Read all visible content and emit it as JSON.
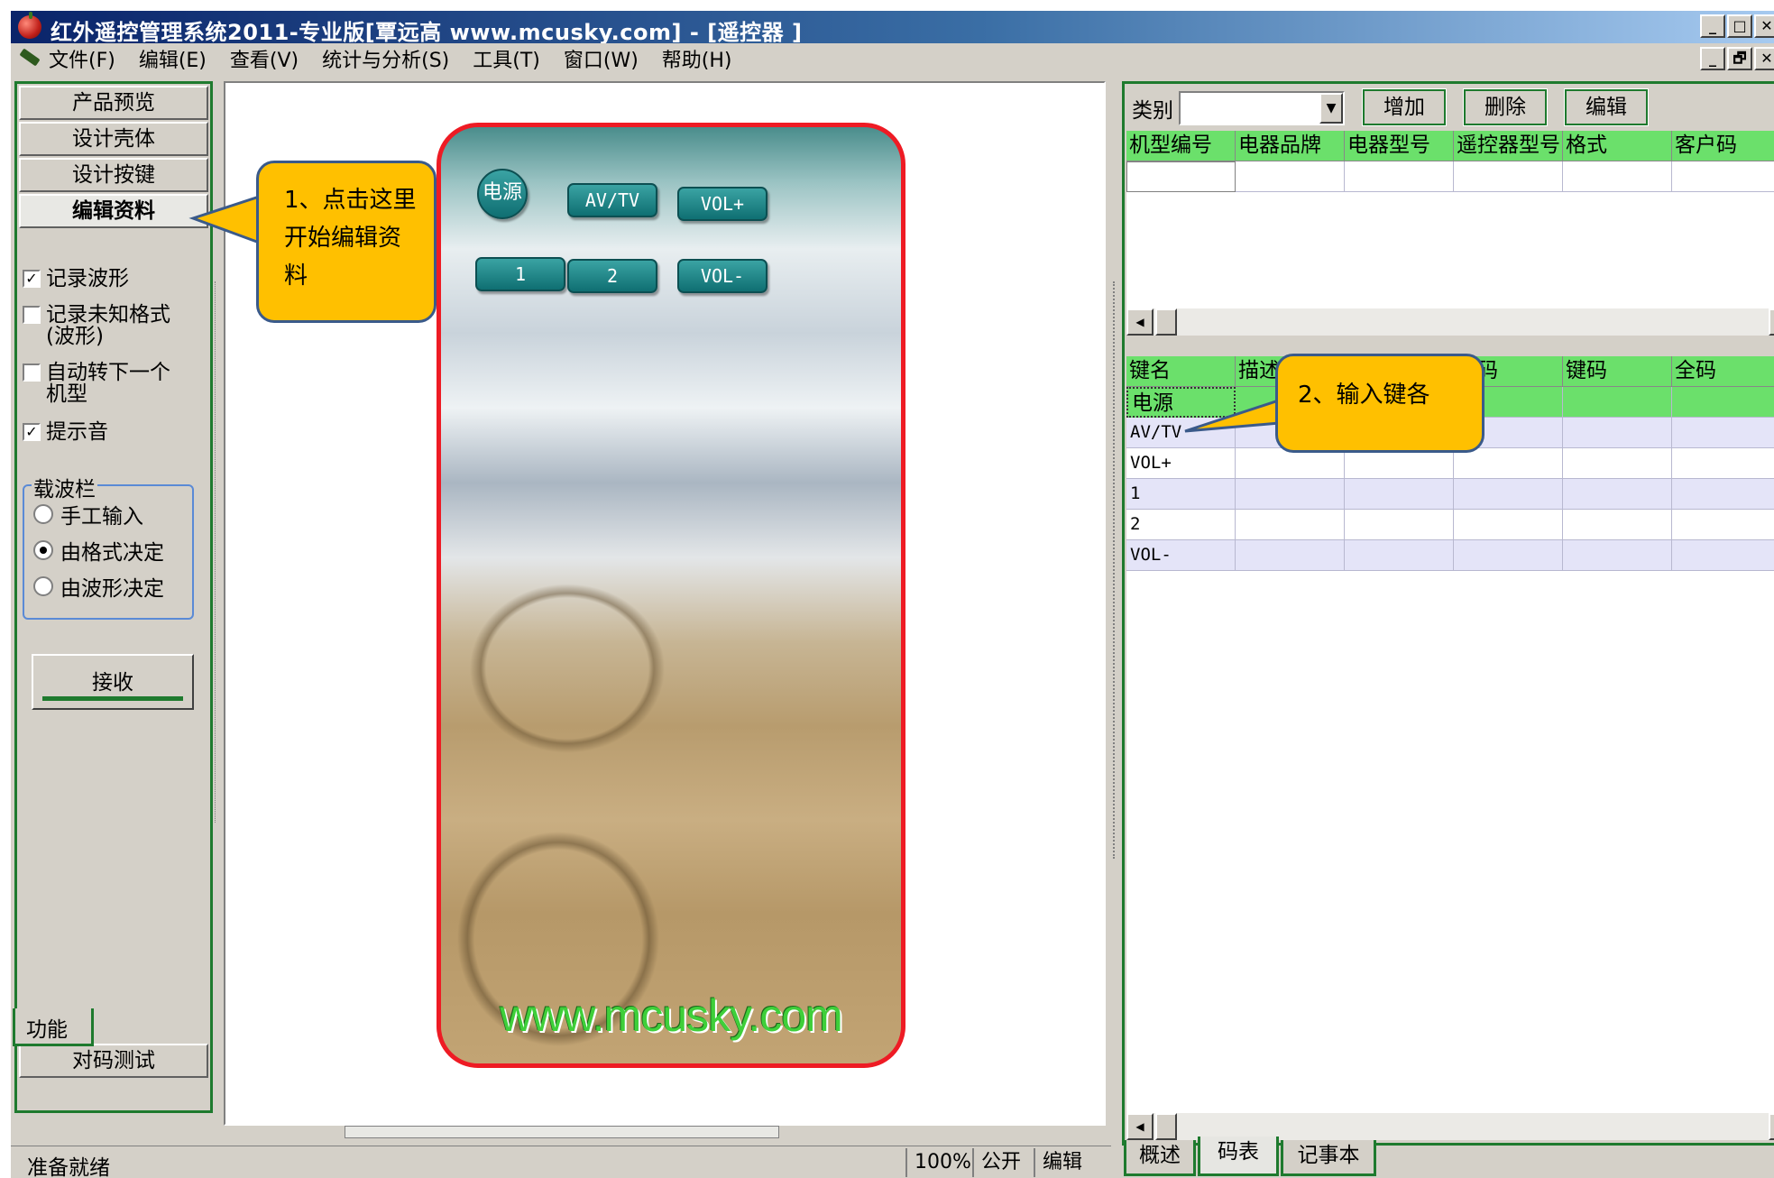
{
  "window": {
    "title": "红外遥控管理系统2011-专业版[覃远高 www.mcusky.com] - [遥控器 ]",
    "controls": [
      "_",
      "□",
      "✕"
    ],
    "mdi_controls": [
      "_",
      "🗗",
      "✕"
    ]
  },
  "menu": [
    "文件(F)",
    "编辑(E)",
    "查看(V)",
    "统计与分析(S)",
    "工具(T)",
    "窗口(W)",
    "帮助(H)"
  ],
  "left_panel": {
    "nav": [
      "产品预览",
      "设计壳体",
      "设计按键",
      "编辑资料"
    ],
    "active_nav": "编辑资料",
    "checks": [
      {
        "label": "记录波形",
        "checked": true
      },
      {
        "label": "记录未知格式\n(波形)",
        "checked": false
      },
      {
        "label": "自动转下一个\n机型",
        "checked": false
      },
      {
        "label": "提示音",
        "checked": true
      }
    ],
    "carrier_group": {
      "label": "载波栏",
      "options": [
        {
          "label": "手工输入",
          "selected": false
        },
        {
          "label": "由格式决定",
          "selected": true
        },
        {
          "label": "由波形决定",
          "selected": false
        }
      ]
    },
    "receive_button": "接收",
    "bottom_nav": "对码测试",
    "tab": "功能"
  },
  "remote": {
    "buttons": {
      "power": "电源",
      "avtv": "AV/TV",
      "volup": "VOL+",
      "one": "1",
      "two": "2",
      "voldown": "VOL-"
    },
    "watermark": "www.mcusky.com",
    "border_color": "#ee1b24"
  },
  "callouts": {
    "step1": "1、点击这里开始编辑资料",
    "step2": "2、输入键各",
    "fill": "#ffc000"
  },
  "right_panel": {
    "category_label": "类别",
    "category_value": "",
    "buttons": {
      "add": "增加",
      "delete": "删除",
      "edit": "编辑"
    },
    "model_table": {
      "columns": [
        "机型编号",
        "电器品牌",
        "电器型号",
        "遥控器型号",
        "格式",
        "客户码"
      ]
    },
    "key_table": {
      "columns": [
        "键名",
        "描述",
        "",
        "户码",
        "键码",
        "全码"
      ],
      "rows": [
        "电源",
        "AV/TV",
        "VOL+",
        "1",
        "2",
        "VOL-"
      ]
    },
    "tabs": [
      "概述",
      "码表",
      "记事本"
    ],
    "active_tab": "码表"
  },
  "status": {
    "text": "准备就绪",
    "zoom": "100%",
    "mode": "公开",
    "state": "编辑"
  },
  "colors": {
    "accent_green": "#1e7a2e",
    "header_green": "#6be06b",
    "title_blue": "#0a246a"
  }
}
